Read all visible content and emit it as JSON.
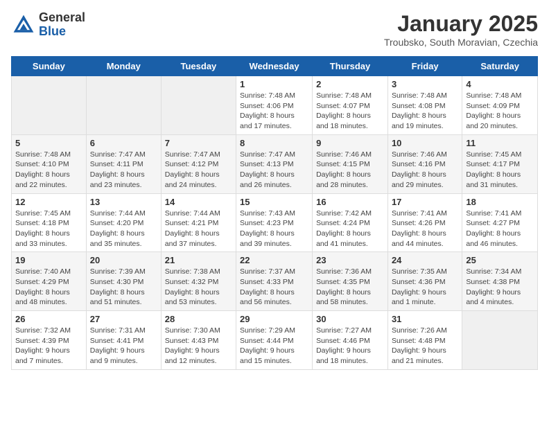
{
  "header": {
    "logo_general": "General",
    "logo_blue": "Blue",
    "month_title": "January 2025",
    "location": "Troubsko, South Moravian, Czechia"
  },
  "weekdays": [
    "Sunday",
    "Monday",
    "Tuesday",
    "Wednesday",
    "Thursday",
    "Friday",
    "Saturday"
  ],
  "weeks": [
    [
      {
        "day": "",
        "info": ""
      },
      {
        "day": "",
        "info": ""
      },
      {
        "day": "",
        "info": ""
      },
      {
        "day": "1",
        "info": "Sunrise: 7:48 AM\nSunset: 4:06 PM\nDaylight: 8 hours\nand 17 minutes."
      },
      {
        "day": "2",
        "info": "Sunrise: 7:48 AM\nSunset: 4:07 PM\nDaylight: 8 hours\nand 18 minutes."
      },
      {
        "day": "3",
        "info": "Sunrise: 7:48 AM\nSunset: 4:08 PM\nDaylight: 8 hours\nand 19 minutes."
      },
      {
        "day": "4",
        "info": "Sunrise: 7:48 AM\nSunset: 4:09 PM\nDaylight: 8 hours\nand 20 minutes."
      }
    ],
    [
      {
        "day": "5",
        "info": "Sunrise: 7:48 AM\nSunset: 4:10 PM\nDaylight: 8 hours\nand 22 minutes."
      },
      {
        "day": "6",
        "info": "Sunrise: 7:47 AM\nSunset: 4:11 PM\nDaylight: 8 hours\nand 23 minutes."
      },
      {
        "day": "7",
        "info": "Sunrise: 7:47 AM\nSunset: 4:12 PM\nDaylight: 8 hours\nand 24 minutes."
      },
      {
        "day": "8",
        "info": "Sunrise: 7:47 AM\nSunset: 4:13 PM\nDaylight: 8 hours\nand 26 minutes."
      },
      {
        "day": "9",
        "info": "Sunrise: 7:46 AM\nSunset: 4:15 PM\nDaylight: 8 hours\nand 28 minutes."
      },
      {
        "day": "10",
        "info": "Sunrise: 7:46 AM\nSunset: 4:16 PM\nDaylight: 8 hours\nand 29 minutes."
      },
      {
        "day": "11",
        "info": "Sunrise: 7:45 AM\nSunset: 4:17 PM\nDaylight: 8 hours\nand 31 minutes."
      }
    ],
    [
      {
        "day": "12",
        "info": "Sunrise: 7:45 AM\nSunset: 4:18 PM\nDaylight: 8 hours\nand 33 minutes."
      },
      {
        "day": "13",
        "info": "Sunrise: 7:44 AM\nSunset: 4:20 PM\nDaylight: 8 hours\nand 35 minutes."
      },
      {
        "day": "14",
        "info": "Sunrise: 7:44 AM\nSunset: 4:21 PM\nDaylight: 8 hours\nand 37 minutes."
      },
      {
        "day": "15",
        "info": "Sunrise: 7:43 AM\nSunset: 4:23 PM\nDaylight: 8 hours\nand 39 minutes."
      },
      {
        "day": "16",
        "info": "Sunrise: 7:42 AM\nSunset: 4:24 PM\nDaylight: 8 hours\nand 41 minutes."
      },
      {
        "day": "17",
        "info": "Sunrise: 7:41 AM\nSunset: 4:26 PM\nDaylight: 8 hours\nand 44 minutes."
      },
      {
        "day": "18",
        "info": "Sunrise: 7:41 AM\nSunset: 4:27 PM\nDaylight: 8 hours\nand 46 minutes."
      }
    ],
    [
      {
        "day": "19",
        "info": "Sunrise: 7:40 AM\nSunset: 4:29 PM\nDaylight: 8 hours\nand 48 minutes."
      },
      {
        "day": "20",
        "info": "Sunrise: 7:39 AM\nSunset: 4:30 PM\nDaylight: 8 hours\nand 51 minutes."
      },
      {
        "day": "21",
        "info": "Sunrise: 7:38 AM\nSunset: 4:32 PM\nDaylight: 8 hours\nand 53 minutes."
      },
      {
        "day": "22",
        "info": "Sunrise: 7:37 AM\nSunset: 4:33 PM\nDaylight: 8 hours\nand 56 minutes."
      },
      {
        "day": "23",
        "info": "Sunrise: 7:36 AM\nSunset: 4:35 PM\nDaylight: 8 hours\nand 58 minutes."
      },
      {
        "day": "24",
        "info": "Sunrise: 7:35 AM\nSunset: 4:36 PM\nDaylight: 9 hours\nand 1 minute."
      },
      {
        "day": "25",
        "info": "Sunrise: 7:34 AM\nSunset: 4:38 PM\nDaylight: 9 hours\nand 4 minutes."
      }
    ],
    [
      {
        "day": "26",
        "info": "Sunrise: 7:32 AM\nSunset: 4:39 PM\nDaylight: 9 hours\nand 7 minutes."
      },
      {
        "day": "27",
        "info": "Sunrise: 7:31 AM\nSunset: 4:41 PM\nDaylight: 9 hours\nand 9 minutes."
      },
      {
        "day": "28",
        "info": "Sunrise: 7:30 AM\nSunset: 4:43 PM\nDaylight: 9 hours\nand 12 minutes."
      },
      {
        "day": "29",
        "info": "Sunrise: 7:29 AM\nSunset: 4:44 PM\nDaylight: 9 hours\nand 15 minutes."
      },
      {
        "day": "30",
        "info": "Sunrise: 7:27 AM\nSunset: 4:46 PM\nDaylight: 9 hours\nand 18 minutes."
      },
      {
        "day": "31",
        "info": "Sunrise: 7:26 AM\nSunset: 4:48 PM\nDaylight: 9 hours\nand 21 minutes."
      },
      {
        "day": "",
        "info": ""
      }
    ]
  ]
}
